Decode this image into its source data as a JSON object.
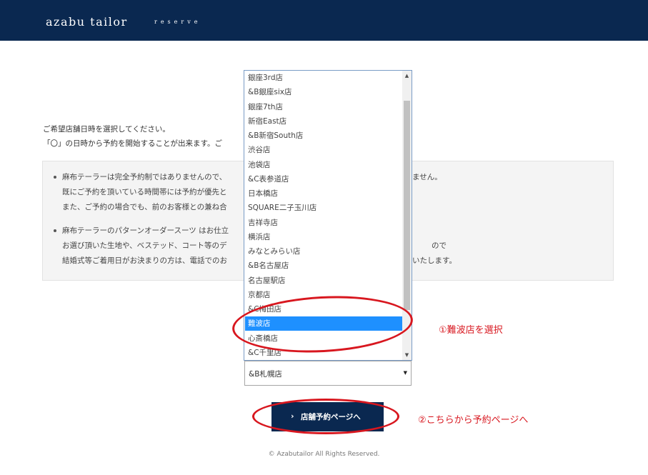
{
  "header": {
    "brand": "azabu tailor",
    "sub": "reserve"
  },
  "intro": {
    "line1": "ご希望店舗日時を選択してください。",
    "line2": "「〇」の日時から予約を開始することが出来ます。ご"
  },
  "notice": {
    "item1": {
      "l1": "麻布テーラーは完全予約制ではありませんので、",
      "l1_tail": "ません。",
      "l2": "既にご予約を頂いている時間帯には予約が優先と",
      "l3": "また、ご予約の場合でも、前のお客様との兼ね合"
    },
    "item2": {
      "l1": "麻布テーラーのパターンオーダースーツ はお仕立",
      "l2": "お選び頂いた生地や、ベステッド、コート等のデ",
      "l2_tail": "ので",
      "l3": "結婚式等ご着用日がお決まりの方は、電話でのお",
      "l3_tail": "いたします。"
    }
  },
  "listbox": {
    "options": [
      "銀座3rd店",
      "&B銀座six店",
      "銀座7th店",
      "新宿East店",
      "&B新宿South店",
      "渋谷店",
      "池袋店",
      "&C表参道店",
      "日本橋店",
      "SQUARE二子玉川店",
      "吉祥寺店",
      "横浜店",
      "みなとみらい店",
      "&B名古屋店",
      "名古屋駅店",
      "京都店",
      "&C梅田店",
      "難波店",
      "心斎橋店",
      "&C千里店"
    ],
    "selected_index": 17
  },
  "select": {
    "value": "&B札幌店"
  },
  "button": {
    "label": "店舗予約ページへ",
    "chevron": "›"
  },
  "annotations": {
    "a1": "①難波店を選択",
    "a2": "②こちらから予約ページへ"
  },
  "footer": {
    "copyright": "© Azabutailor All Rights Reserved."
  },
  "colors": {
    "header_bg": "#0a2850",
    "selected_bg": "#1e90ff",
    "annotation": "#d8171f"
  }
}
